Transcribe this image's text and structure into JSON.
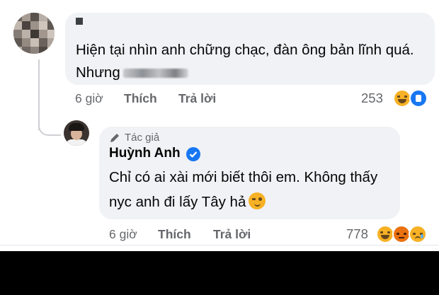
{
  "comment": {
    "text_before_redaction": "Hiện tại nhìn anh chững chạc, đàn ông bản lĩnh quá. Nhưng",
    "time": "6 giờ",
    "like_label": "Thích",
    "reply_label": "Trả lời",
    "reaction_count": "253",
    "reactions": [
      "haha-icon",
      "like-icon"
    ]
  },
  "reply": {
    "author_badge": "Tác giả",
    "author_name": "Huỳnh Anh",
    "text": "Chỉ có ai xài mới biết thôi em. Không thấy nyc anh đi lấy Tây hả",
    "time": "6 giờ",
    "like_label": "Thích",
    "reply_label": "Trả lời",
    "reaction_count": "778",
    "reactions": [
      "haha-icon",
      "angry-icon",
      "sad-icon"
    ]
  },
  "colors": {
    "bubble": "#f0f2f5",
    "meta_text": "#65676b",
    "facebook_blue": "#1877f2"
  }
}
